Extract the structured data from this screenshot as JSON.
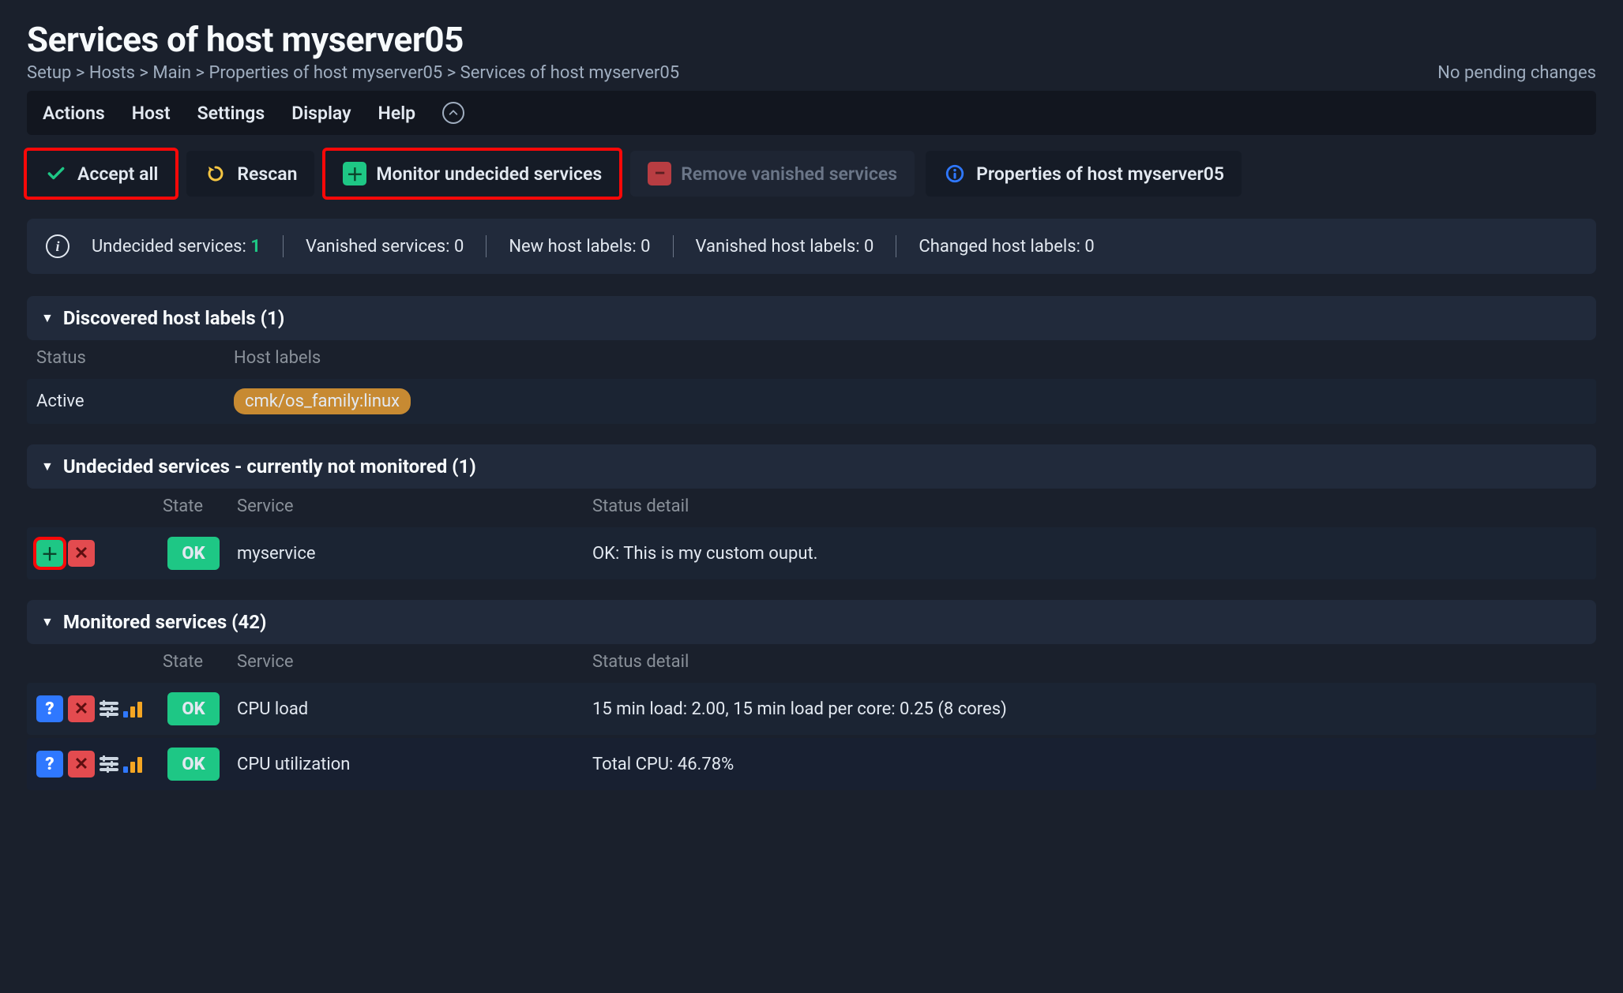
{
  "title": "Services of host myserver05",
  "breadcrumbs": "Setup > Hosts > Main > Properties of host myserver05 > Services of host myserver05",
  "pending": "No pending changes",
  "menu": {
    "actions": "Actions",
    "host": "Host",
    "settings": "Settings",
    "display": "Display",
    "help": "Help"
  },
  "toolbar": {
    "accept_all": "Accept all",
    "rescan": "Rescan",
    "monitor_undecided": "Monitor undecided services",
    "remove_vanished": "Remove vanished services",
    "properties": "Properties of host myserver05"
  },
  "summary": {
    "undecided_label": "Undecided services:",
    "undecided_value": "1",
    "vanished_label": "Vanished services:",
    "vanished_value": "0",
    "new_labels_label": "New host labels:",
    "new_labels_value": "0",
    "vanished_labels_label": "Vanished host labels:",
    "vanished_labels_value": "0",
    "changed_labels_label": "Changed host labels:",
    "changed_labels_value": "0"
  },
  "host_labels_section": {
    "title": "Discovered host labels (1)",
    "col_status": "Status",
    "col_labels": "Host labels",
    "row_status": "Active",
    "row_label": "cmk/os_family:linux"
  },
  "undecided_section": {
    "title": "Undecided services - currently not monitored (1)",
    "col_state": "State",
    "col_service": "Service",
    "col_detail": "Status detail",
    "rows": [
      {
        "state": "OK",
        "service": "myservice",
        "detail": "OK: This is my custom ouput."
      }
    ]
  },
  "monitored_section": {
    "title": "Monitored services (42)",
    "col_state": "State",
    "col_service": "Service",
    "col_detail": "Status detail",
    "rows": [
      {
        "state": "OK",
        "service": "CPU load",
        "detail": "15 min load: 2.00, 15 min load per core: 0.25 (8 cores)"
      },
      {
        "state": "OK",
        "service": "CPU utilization",
        "detail": "Total CPU: 46.78%"
      }
    ]
  }
}
